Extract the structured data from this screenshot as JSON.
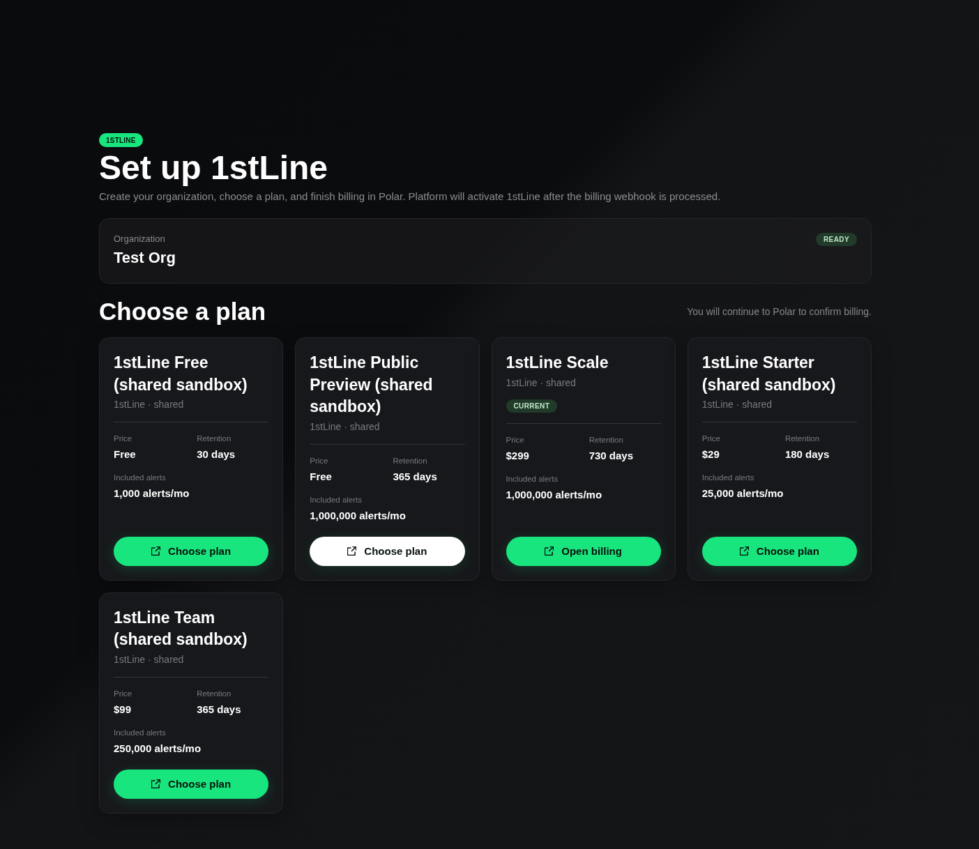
{
  "brand_badge": "1STLINE",
  "title": "Set up 1stLine",
  "subtitle": "Create your organization, choose a plan, and finish billing in Polar. Platform will activate 1stLine after the billing webhook is processed.",
  "organization": {
    "label": "Organization",
    "name": "Test Org",
    "status": "READY"
  },
  "plans_section": {
    "heading": "Choose a plan",
    "note": "You will continue to Polar to confirm billing."
  },
  "plans": [
    {
      "name": "1stLine Free (shared sandbox)",
      "meta": "1stLine · shared",
      "stats": [
        {
          "label": "Price",
          "value": "Free"
        },
        {
          "label": "Retention",
          "value": "30 days"
        },
        {
          "label": "Included alerts",
          "value": "1,000 alerts/mo"
        }
      ],
      "button": {
        "label": "Choose plan",
        "highlighted": false
      }
    },
    {
      "name": "1stLine Public Preview (shared sandbox)",
      "meta": "1stLine · shared",
      "stats": [
        {
          "label": "Price",
          "value": "Free"
        },
        {
          "label": "Retention",
          "value": "365 days"
        },
        {
          "label": "Included alerts",
          "value": "1,000,000 alerts/mo"
        }
      ],
      "button": {
        "label": "Choose plan",
        "highlighted": true
      }
    },
    {
      "name": "1stLine Scale",
      "meta": "1stLine · shared",
      "badge": "CURRENT",
      "stats": [
        {
          "label": "Price",
          "value": "$299"
        },
        {
          "label": "Retention",
          "value": "730 days"
        },
        {
          "label": "Included alerts",
          "value": "1,000,000 alerts/mo"
        }
      ],
      "button": {
        "label": "Open billing",
        "highlighted": false
      }
    },
    {
      "name": "1stLine Starter (shared sandbox)",
      "meta": "1stLine · shared",
      "stats": [
        {
          "label": "Price",
          "value": "$29"
        },
        {
          "label": "Retention",
          "value": "180 days"
        },
        {
          "label": "Included alerts",
          "value": "25,000 alerts/mo"
        }
      ],
      "button": {
        "label": "Choose plan",
        "highlighted": false
      }
    },
    {
      "name": "1stLine Team (shared sandbox)",
      "meta": "1stLine · shared",
      "stats": [
        {
          "label": "Price",
          "value": "$99"
        },
        {
          "label": "Retention",
          "value": "365 days"
        },
        {
          "label": "Included alerts",
          "value": "250,000 alerts/mo"
        }
      ],
      "button": {
        "label": "Choose plan",
        "highlighted": false
      }
    }
  ]
}
